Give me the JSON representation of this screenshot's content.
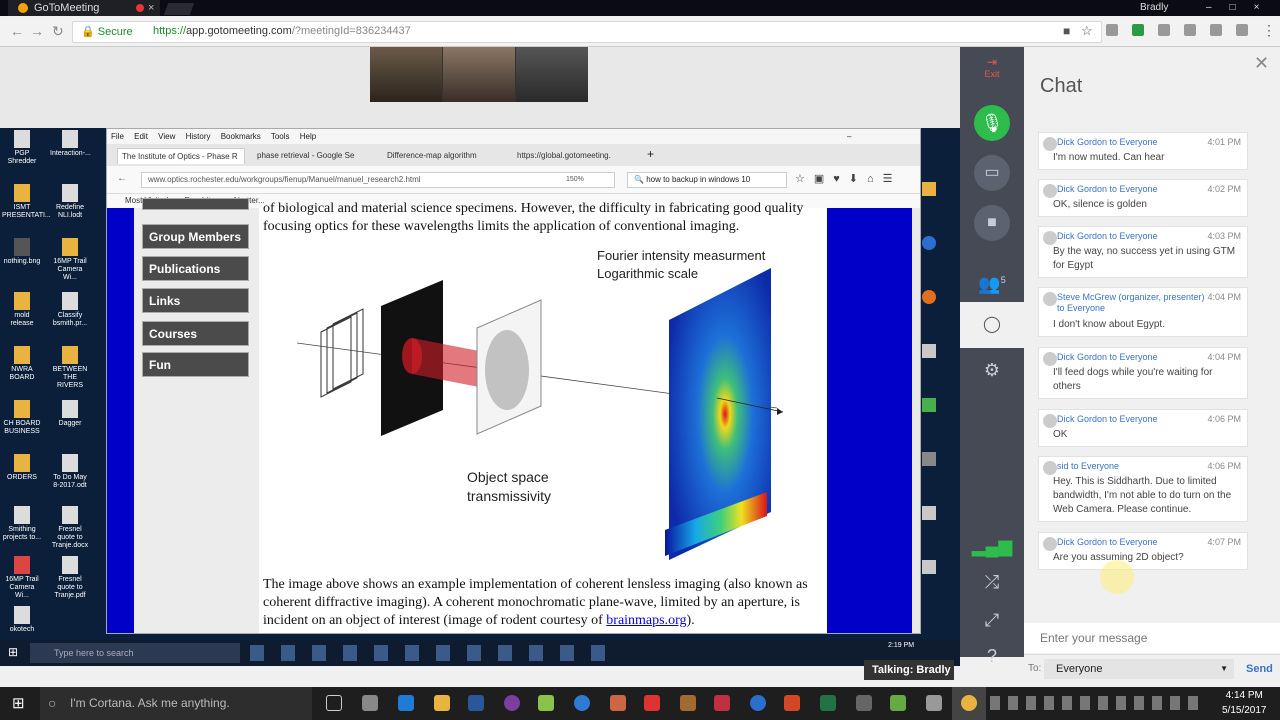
{
  "browser": {
    "tab_title": "GoToMeeting",
    "user": "Bradly",
    "secure": "Secure",
    "url_scheme": "https://",
    "url_host": "app.gotomeeting.com",
    "url_rest": "/?meetingId=836234437"
  },
  "shared": {
    "menu": [
      "File",
      "Edit",
      "View",
      "History",
      "Bookmarks",
      "Tools",
      "Help"
    ],
    "tabs": [
      "The Institute of Optics - Phase R",
      "phase retrieval - Google Se",
      "Difference-map algorithm",
      "https://global.gotomeeting."
    ],
    "url": "www.optics.rochester.edu/workgroups/fienup/Manuel/manuel_research2.html",
    "zoom": "150%",
    "search": "how to backup in windows 10",
    "bookmarks": [
      "Most Visited",
      "Dendrite-proof batter..."
    ],
    "nav": [
      "Group Members",
      "Publications",
      "Links",
      "Courses",
      "Fun"
    ],
    "text_top": "of biological and material science specimens. However, the difficulty in fabricating good quality focusing optics for these wavelengths limits the application of conventional imaging.",
    "figure": {
      "label_fourier_1": "Fourier intensity measurment",
      "label_fourier_2": "Logarithmic scale",
      "label_object_1": "Object space",
      "label_object_2": "transmissivity"
    },
    "text_bottom_1": "The image above shows an example implementation of coherent lensless imaging (also known as coherent diffractive imaging). A coherent monochromatic plane-wave, limited by an aperture, is incident on an object of interest (image of rodent courtesy of ",
    "link": "brainmaps.org",
    "text_bottom_2": ").",
    "taskbar_search": "Type here to search",
    "clock": "2:19 PM"
  },
  "talking": "Talking: Bradly",
  "desktop_icons": [
    "PGP Shredder",
    "Interaction-...",
    "ISMT PRESENTATI...",
    "Redefine NLI.lodt",
    "nothing.bng",
    "16MP Trail Camera Wi...",
    "mold release",
    "Classify bsmith.pr...",
    "NWRA BOARD",
    "BETWEEN THE RIVERS",
    "CH BOARD BUSINESS",
    "Dagger",
    "ORDERS",
    "To Do May 8-2017.odt",
    "Smithing projects to...",
    "Fresnel quote to Tranje.docx",
    "16MP Trail Camera Wi...",
    "Fresnel quote to Tranje.pdf",
    "okotech"
  ],
  "gtm": {
    "exit": "Exit",
    "attendees": "5"
  },
  "chat": {
    "title": "Chat",
    "messages": [
      {
        "from": "Dick Gordon to Everyone",
        "time": "4:01 PM",
        "text": "I'm now muted. Can hear"
      },
      {
        "from": "Dick Gordon to Everyone",
        "time": "4:02 PM",
        "text": "OK, silence is golden"
      },
      {
        "from": "Dick Gordon to Everyone",
        "time": "4:03 PM",
        "text": "By the way, no success yet in using GTM for Egypt"
      },
      {
        "from": "Steve McGrew (organizer, presenter) to Everyone",
        "time": "4:04 PM",
        "text": "I don't know about Egypt."
      },
      {
        "from": "Dick Gordon to Everyone",
        "time": "4:04 PM",
        "text": "I'll feed dogs while you're waiting for others"
      },
      {
        "from": "Dick Gordon to Everyone",
        "time": "4:06 PM",
        "text": "OK"
      },
      {
        "from": "sid to Everyone",
        "time": "4:06 PM",
        "text": "Hey. This is Siddharth. Due to limited bandwidth, I'm not able to do turn on the Web Camera. Please continue."
      },
      {
        "from": "Dick Gordon to Everyone",
        "time": "4:07 PM",
        "text": "Are you assuming 2D object?"
      }
    ],
    "input_placeholder": "Enter your message",
    "to_label": "To:",
    "to_value": "Everyone",
    "send": "Send"
  },
  "taskbar": {
    "cortana": "I'm Cortana. Ask me anything.",
    "time": "4:14 PM",
    "date": "5/15/2017"
  }
}
